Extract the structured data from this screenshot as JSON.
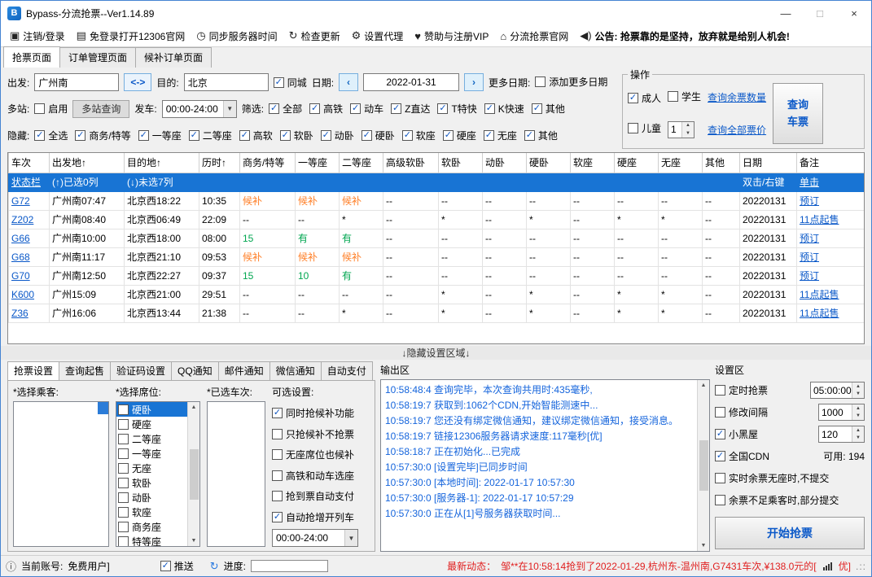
{
  "window": {
    "title": "Bypass-分流抢票--Ver1.14.89",
    "minimize": "—",
    "maximize": "□",
    "close": "×"
  },
  "colors": {
    "accent": "#1874d4",
    "link": "#0a58c8",
    "waitlist_orange": "#ff7f27",
    "available_green": "#00a650",
    "alert_red": "#e02020"
  },
  "menubar": [
    {
      "icon": "login-icon",
      "label": "注销/登录",
      "bold": false
    },
    {
      "icon": "browser-icon",
      "label": "免登录打开12306官网",
      "bold": false
    },
    {
      "icon": "clock-icon",
      "label": "同步服务器时间",
      "bold": false
    },
    {
      "icon": "refresh-icon",
      "label": "检查更新",
      "bold": false
    },
    {
      "icon": "proxy-icon",
      "label": "设置代理",
      "bold": false
    },
    {
      "icon": "vip-icon",
      "label": "赞助与注册VIP",
      "bold": false
    },
    {
      "icon": "home-icon",
      "label": "分流抢票官网",
      "bold": false
    },
    {
      "icon": "announcement-icon",
      "label": "公告: 抢票靠的是坚持，放弃就是给别人机会!",
      "bold": true
    }
  ],
  "page_tabs": [
    {
      "label": "抢票页面",
      "active": true
    },
    {
      "label": "订单管理页面",
      "active": false
    },
    {
      "label": "候补订单页面",
      "active": false
    }
  ],
  "query": {
    "depart_label": "出发:",
    "depart_value": "广州南",
    "swap_label": "<->",
    "dest_label": "目的:",
    "dest_value": "北京",
    "same_city": {
      "label": "同城",
      "checked": true
    },
    "date_label": "日期:",
    "prev_label": "‹",
    "date_value": "2022-01-31",
    "next_label": "›",
    "more_date_label": "更多日期:",
    "add_more_dates": {
      "label": "添加更多日期",
      "checked": false
    },
    "multi_label": "多站:",
    "multi_enable": {
      "label": "启用",
      "checked": false
    },
    "multi_query_btn": "多站查询",
    "depart_time_label": "发车:",
    "depart_time_value": "00:00-24:00",
    "filter_label": "筛选:",
    "filters": [
      {
        "label": "全部",
        "checked": true
      },
      {
        "label": "高铁",
        "checked": true
      },
      {
        "label": "动车",
        "checked": true
      },
      {
        "label": "Z直达",
        "checked": true
      },
      {
        "label": "T特快",
        "checked": true
      },
      {
        "label": "K快速",
        "checked": true
      },
      {
        "label": "其他",
        "checked": true
      }
    ],
    "hide_label": "隐藏:",
    "hide_options": [
      {
        "label": "全选",
        "checked": true
      },
      {
        "label": "商务/特等",
        "checked": true
      },
      {
        "label": "一等座",
        "checked": true
      },
      {
        "label": "二等座",
        "checked": true
      },
      {
        "label": "高软",
        "checked": true
      },
      {
        "label": "软卧",
        "checked": true
      },
      {
        "label": "动卧",
        "checked": true
      },
      {
        "label": "硬卧",
        "checked": true
      },
      {
        "label": "软座",
        "checked": true
      },
      {
        "label": "硬座",
        "checked": true
      },
      {
        "label": "无座",
        "checked": true
      },
      {
        "label": "其他",
        "checked": true
      }
    ]
  },
  "operation": {
    "title": "操作",
    "adult": {
      "label": "成人",
      "checked": true
    },
    "student": {
      "label": "学生",
      "checked": false
    },
    "child": {
      "label": "儿童",
      "checked": false
    },
    "child_count": "1",
    "query_tickets_link": "查询余票数量",
    "query_price_link": "查询全部票价",
    "query_button": "查询\n车票"
  },
  "table": {
    "columns": [
      "车次",
      "出发地↑",
      "目的地↑",
      "历时↑",
      "商务/特等",
      "一等座",
      "二等座",
      "高级软卧",
      "软卧",
      "动卧",
      "硬卧",
      "软座",
      "硬座",
      "无座",
      "其他",
      "日期",
      "备注"
    ],
    "status_row": [
      "状态栏",
      "(↑)已选0列",
      "(↓)未选7列",
      "",
      "",
      "",
      "",
      "",
      "",
      "",
      "",
      "",
      "",
      "",
      "",
      "双击/右键",
      "单击"
    ],
    "rows": [
      {
        "train": "G72",
        "from": "广州南07:47",
        "to": "北京西18:22",
        "duration": "10:35",
        "seats": [
          "候补",
          "候补",
          "候补",
          "--",
          "--",
          "--",
          "--",
          "--",
          "--",
          "--",
          "--"
        ],
        "date": "20220131",
        "note": "预订"
      },
      {
        "train": "Z202",
        "from": "广州南08:40",
        "to": "北京西06:49",
        "duration": "22:09",
        "seats": [
          "--",
          "--",
          "*",
          "--",
          "*",
          "--",
          "*",
          "--",
          "*",
          "*",
          "--"
        ],
        "date": "20220131",
        "note": "11点起售"
      },
      {
        "train": "G66",
        "from": "广州南10:00",
        "to": "北京西18:00",
        "duration": "08:00",
        "seats": [
          "15",
          "有",
          "有",
          "--",
          "--",
          "--",
          "--",
          "--",
          "--",
          "--",
          "--"
        ],
        "date": "20220131",
        "note": "预订"
      },
      {
        "train": "G68",
        "from": "广州南11:17",
        "to": "北京西21:10",
        "duration": "09:53",
        "seats": [
          "候补",
          "候补",
          "候补",
          "--",
          "--",
          "--",
          "--",
          "--",
          "--",
          "--",
          "--"
        ],
        "date": "20220131",
        "note": "预订"
      },
      {
        "train": "G70",
        "from": "广州南12:50",
        "to": "北京西22:27",
        "duration": "09:37",
        "seats": [
          "15",
          "10",
          "有",
          "--",
          "--",
          "--",
          "--",
          "--",
          "--",
          "--",
          "--"
        ],
        "date": "20220131",
        "note": "预订"
      },
      {
        "train": "K600",
        "from": "广州15:09",
        "to": "北京西21:00",
        "duration": "29:51",
        "seats": [
          "--",
          "--",
          "--",
          "--",
          "*",
          "--",
          "*",
          "--",
          "*",
          "*",
          "--"
        ],
        "date": "20220131",
        "note": "11点起售"
      },
      {
        "train": "Z36",
        "from": "广州16:06",
        "to": "北京西13:44",
        "duration": "21:38",
        "seats": [
          "--",
          "--",
          "*",
          "--",
          "*",
          "--",
          "*",
          "--",
          "*",
          "*",
          "--"
        ],
        "date": "20220131",
        "note": "11点起售"
      }
    ]
  },
  "divider_label": "↓隐藏设置区域↓",
  "bottom_tabs": [
    {
      "label": "抢票设置",
      "active": true
    },
    {
      "label": "查询起售",
      "active": false
    },
    {
      "label": "验证码设置",
      "active": false
    },
    {
      "label": "QQ通知",
      "active": false
    },
    {
      "label": "邮件通知",
      "active": false
    },
    {
      "label": "微信通知",
      "active": false
    },
    {
      "label": "自动支付",
      "active": false
    }
  ],
  "passenger_list": {
    "label": "*选择乘客:",
    "items": []
  },
  "seat_list": {
    "label": "*选择席位:",
    "items": [
      {
        "label": "硬卧",
        "checked": false,
        "selected": true
      },
      {
        "label": "硬座",
        "checked": false,
        "selected": false
      },
      {
        "label": "二等座",
        "checked": false,
        "selected": false
      },
      {
        "label": "一等座",
        "checked": false,
        "selected": false
      },
      {
        "label": "无座",
        "checked": false,
        "selected": false
      },
      {
        "label": "软卧",
        "checked": false,
        "selected": false
      },
      {
        "label": "动卧",
        "checked": false,
        "selected": false
      },
      {
        "label": "软座",
        "checked": false,
        "selected": false
      },
      {
        "label": "商务座",
        "checked": false,
        "selected": false
      },
      {
        "label": "特等座",
        "checked": false,
        "selected": false
      }
    ]
  },
  "selected_trains": {
    "label": "*已选车次:",
    "items": []
  },
  "optional_settings": {
    "label": "可选设置:",
    "items": [
      {
        "label": "同时抢候补功能",
        "checked": true
      },
      {
        "label": "只抢候补不抢票",
        "checked": false
      },
      {
        "label": "无座席位也候补",
        "checked": false
      },
      {
        "label": "高铁和动车选座",
        "checked": false
      },
      {
        "label": "抢到票自动支付",
        "checked": false
      },
      {
        "label": "自动抢增开列车",
        "checked": true
      }
    ],
    "time_range": "00:00-24:00"
  },
  "output": {
    "label": "输出区",
    "lines": [
      "10:58:48:4  查询完毕，本次查询共用时:435毫秒,",
      "10:58:19:7  获取到:1062个CDN,开始智能测速中...",
      "10:58:19:7  您还没有绑定微信通知，建议绑定微信通知，接受消息。",
      "10:58:19:7  链接12306服务器请求速度:117毫秒[优]",
      "10:58:18:7  正在初始化...已完成",
      "10:57:30:0  [设置完毕]已同步时间",
      "10:57:30:0  [本地时间]: 2022-01-17 10:57:30",
      "10:57:30:0  [服务器-1]:  2022-01-17 10:57:29",
      "10:57:30:0  正在从[1]号服务器获取时间..."
    ]
  },
  "settings": {
    "label": "设置区",
    "rows": [
      {
        "type": "check-spin",
        "label": "定时抢票",
        "checked": false,
        "value": "05:00:00"
      },
      {
        "type": "check-spin",
        "label": "修改间隔",
        "checked": false,
        "value": "1000"
      },
      {
        "type": "check-spin",
        "label": "小黑屋",
        "checked": true,
        "value": "120"
      },
      {
        "type": "check-text",
        "label": "全国CDN",
        "checked": true,
        "suffix": "可用: 194"
      },
      {
        "type": "check",
        "label": "实时余票无座时,不提交",
        "checked": false
      },
      {
        "type": "check",
        "label": "余票不足乘客时,部分提交",
        "checked": false
      }
    ],
    "start_button": "开始抢票"
  },
  "statusbar": {
    "info_icon": "ⓘ",
    "account_label": "当前账号:",
    "account_value": "免费用户]",
    "push": {
      "label": "推送",
      "checked": true
    },
    "refresh_icon": "↻",
    "progress_label": "进度:",
    "news_label": "最新动态：",
    "news_text": "邹**在10:58:14抢到了2022-01-29,杭州东-温州南,G7431车次,¥138.0元的[",
    "net_quality": "优]",
    "size_grip": ".::"
  }
}
